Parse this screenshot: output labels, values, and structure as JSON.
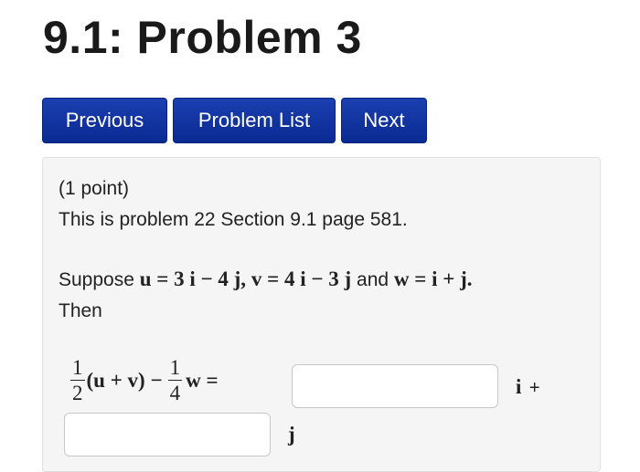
{
  "page": {
    "title": "9.1: Problem 3"
  },
  "nav": {
    "previous": "Previous",
    "problem_list": "Problem List",
    "next": "Next"
  },
  "problem": {
    "points": "(1 point)",
    "reference": "This is problem 22 Section 9.1 page 581.",
    "suppose": "Suppose",
    "and": "and",
    "then": "Then",
    "eq_u": "u = 3 i − 4 j,",
    "eq_v": "v = 4 i − 3 j",
    "eq_w": "w = i + j.",
    "expr_one": "1",
    "expr_two": "2",
    "expr_four": "4",
    "expr_uv": "(u + v) −",
    "expr_w": "w =",
    "i_unit": "i",
    "plus": "+",
    "j_unit": "j"
  },
  "answers": {
    "i_component": "",
    "j_component": ""
  }
}
